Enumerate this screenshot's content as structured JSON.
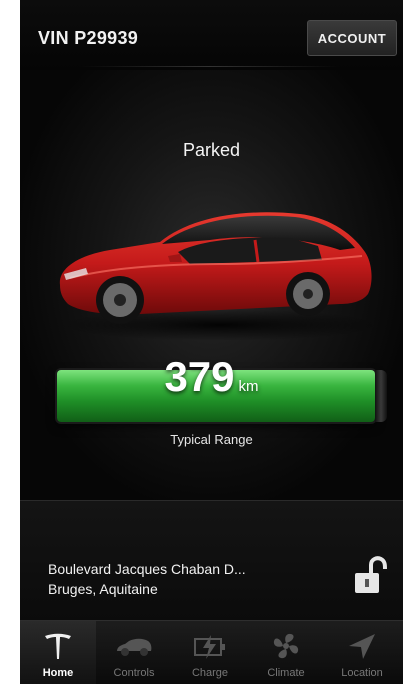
{
  "header": {
    "vin": "VIN P29939",
    "account_label": "ACCOUNT"
  },
  "vehicle": {
    "status": "Parked",
    "range_value": "379",
    "range_unit": "km",
    "range_label": "Typical Range"
  },
  "location": {
    "line1": "Boulevard Jacques Chaban D...",
    "line2": "Bruges, Aquitaine",
    "lock_icon": "unlocked-padlock-icon"
  },
  "tabs": [
    {
      "label": "Home",
      "icon": "tesla-logo-icon",
      "active": true
    },
    {
      "label": "Controls",
      "icon": "car-icon",
      "active": false
    },
    {
      "label": "Charge",
      "icon": "battery-charge-icon",
      "active": false
    },
    {
      "label": "Climate",
      "icon": "fan-icon",
      "active": false
    },
    {
      "label": "Location",
      "icon": "navigation-arrow-icon",
      "active": false
    }
  ],
  "colors": {
    "range_bar": "#39b53f",
    "car_body": "#c41a1a",
    "background": "#050505"
  }
}
